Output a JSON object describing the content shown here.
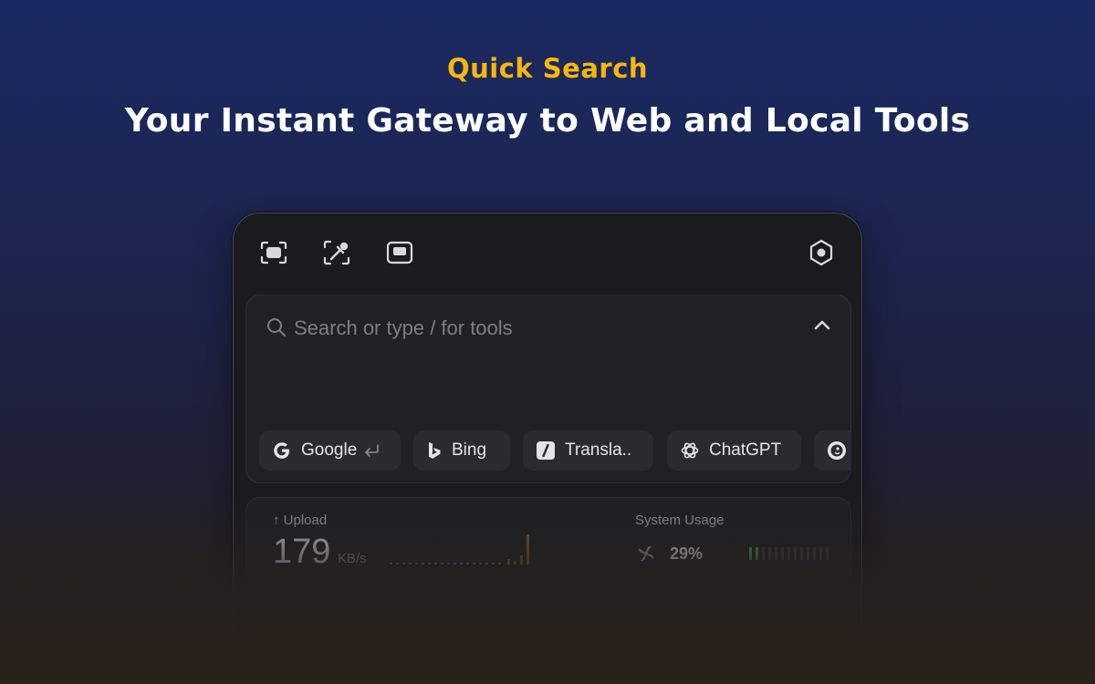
{
  "hero": {
    "kicker": "Quick Search",
    "title": "Your Instant Gateway to Web and Local Tools",
    "kicker_color": "#f6b60e"
  },
  "toolbar": {
    "icons": [
      "screenshot-icon",
      "color-picker-icon",
      "picture-in-picture-icon",
      "settings-icon"
    ]
  },
  "search": {
    "placeholder": "Search or type / for tools",
    "value": ""
  },
  "engines": [
    {
      "label": "Google",
      "icon": "google-icon",
      "default": true
    },
    {
      "label": "Bing",
      "icon": "bing-icon"
    },
    {
      "label": "Transla..",
      "icon": "translate-icon"
    },
    {
      "label": "ChatGPT",
      "icon": "chatgpt-icon"
    },
    {
      "label": "",
      "icon": "duckduckgo-icon"
    }
  ],
  "stats": {
    "upload": {
      "label": "Upload",
      "value": "179",
      "unit": "KB/s"
    },
    "system": {
      "label": "System Usage",
      "value": "29%",
      "usage_fraction": 0.29
    }
  }
}
